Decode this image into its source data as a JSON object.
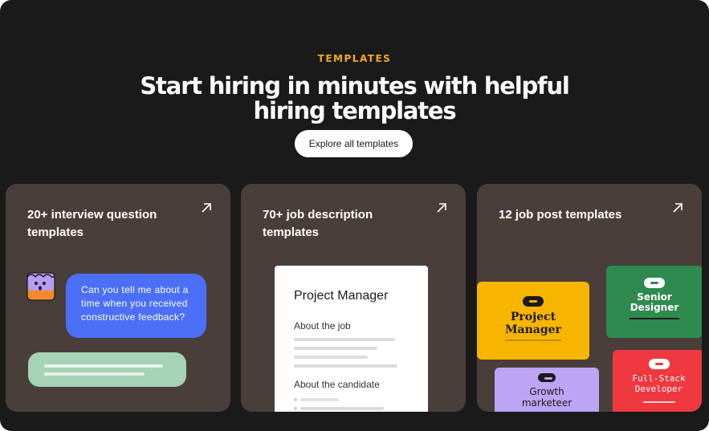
{
  "section": {
    "eyebrow": "TEMPLATES",
    "headline": "Start hiring in minutes with helpful hiring templates",
    "cta_label": "Explore all templates"
  },
  "cards": [
    {
      "title": "20+ interview question templates",
      "bubble_text": "Can you tell me about a time when you received constructive feedback?"
    },
    {
      "title": "70+ job description templates",
      "doc_title": "Project Manager",
      "doc_section_1": "About the job",
      "doc_section_2": "About the candidate"
    },
    {
      "title": "12 job post templates",
      "tiles": [
        {
          "label": "Project Manager"
        },
        {
          "label": "Senior Designer"
        },
        {
          "label": "Growth marketeer"
        },
        {
          "label": "Full-Stack Developer"
        }
      ]
    }
  ],
  "colors": {
    "background": "#1b1a1a",
    "card": "#4a3e3b",
    "accent": "#f2a81d",
    "chat_blue": "#4c6ff7",
    "chat_green": "#a5d3b4",
    "tile_yellow": "#f7b500",
    "tile_green": "#2f8a4f",
    "tile_purple": "#bda4f5",
    "tile_red": "#f0383f"
  },
  "icons": {
    "card_arrow": "arrow-up-right-icon",
    "avatar": "monster-avatar-icon"
  }
}
